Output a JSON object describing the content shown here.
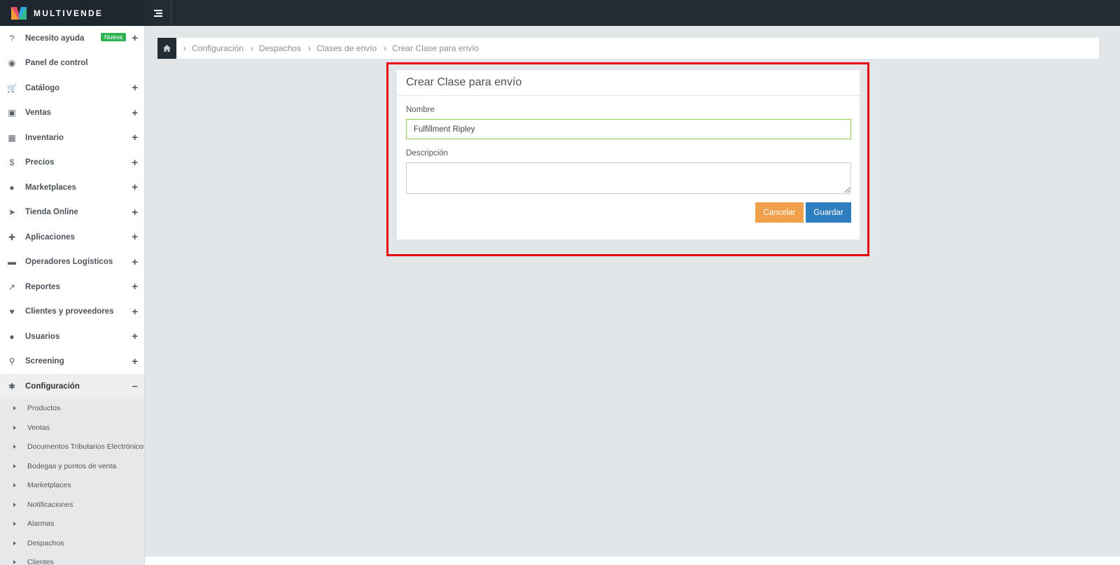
{
  "brand": {
    "name": "MULTIVENDE"
  },
  "sidebar": {
    "items": [
      {
        "key": "help",
        "label": "Necesito ayuda",
        "icon": "question-circle-icon",
        "glyph": "?",
        "badge": "Nueva",
        "expand": "+"
      },
      {
        "key": "dashboard",
        "label": "Panel de control",
        "icon": "dashboard-icon",
        "glyph": "◉",
        "expand": ""
      },
      {
        "key": "catalog",
        "label": "Catálogo",
        "icon": "cart-icon",
        "glyph": "🛒",
        "expand": "+"
      },
      {
        "key": "sales",
        "label": "Ventas",
        "icon": "money-icon",
        "glyph": "▣",
        "expand": "+"
      },
      {
        "key": "inventory",
        "label": "Inventario",
        "icon": "cubes-icon",
        "glyph": "▦",
        "expand": "+"
      },
      {
        "key": "prices",
        "label": "Precios",
        "icon": "dollar-icon",
        "glyph": "$",
        "expand": "+"
      },
      {
        "key": "marketplaces",
        "label": "Marketplaces",
        "icon": "globe-icon",
        "glyph": "●",
        "expand": "+"
      },
      {
        "key": "online-store",
        "label": "Tienda Online",
        "icon": "pointer-icon",
        "glyph": "➤",
        "expand": "+"
      },
      {
        "key": "apps",
        "label": "Aplicaciones",
        "icon": "puzzle-icon",
        "glyph": "✚",
        "expand": "+"
      },
      {
        "key": "logistics",
        "label": "Operadores Logísticos",
        "icon": "truck-icon",
        "glyph": "▬",
        "expand": "+"
      },
      {
        "key": "reports",
        "label": "Reportes",
        "icon": "line-chart-icon",
        "glyph": "↗",
        "expand": "+"
      },
      {
        "key": "clients",
        "label": "Clientes y proveedores",
        "icon": "heart-icon",
        "glyph": "♥",
        "expand": "+"
      },
      {
        "key": "users",
        "label": "Usuarios",
        "icon": "user-icon",
        "glyph": "●",
        "expand": "+"
      },
      {
        "key": "screening",
        "label": "Screening",
        "icon": "search-icon",
        "glyph": "⚲",
        "expand": "+"
      },
      {
        "key": "config",
        "label": "Configuración",
        "icon": "gear-icon",
        "glyph": "✱",
        "expand": "–"
      }
    ],
    "config_sub": [
      "Productos",
      "Ventas",
      "Documentos Tributarios Electrónicos",
      "Bodegas y puntos de venta",
      "Marketplaces",
      "Notificaciones",
      "Alarmas",
      "Despachos",
      "Clientes"
    ]
  },
  "breadcrumb": {
    "items": [
      "Configuración",
      "Despachos",
      "Clases de envío",
      "Crear Clase para envío"
    ]
  },
  "form": {
    "title": "Crear Clase para envío",
    "name_label": "Nombre",
    "name_value": "Fulfillment Ripley",
    "description_label": "Descripción",
    "description_value": "",
    "cancel_label": "Cancelar",
    "save_label": "Guardar"
  },
  "colors": {
    "topbar": "#222c35",
    "success_badge": "#2eb354",
    "cancel": "#f0a04b",
    "save": "#2e7ec0",
    "highlight": "#e8000e",
    "input_focus": "#8fd14f"
  }
}
